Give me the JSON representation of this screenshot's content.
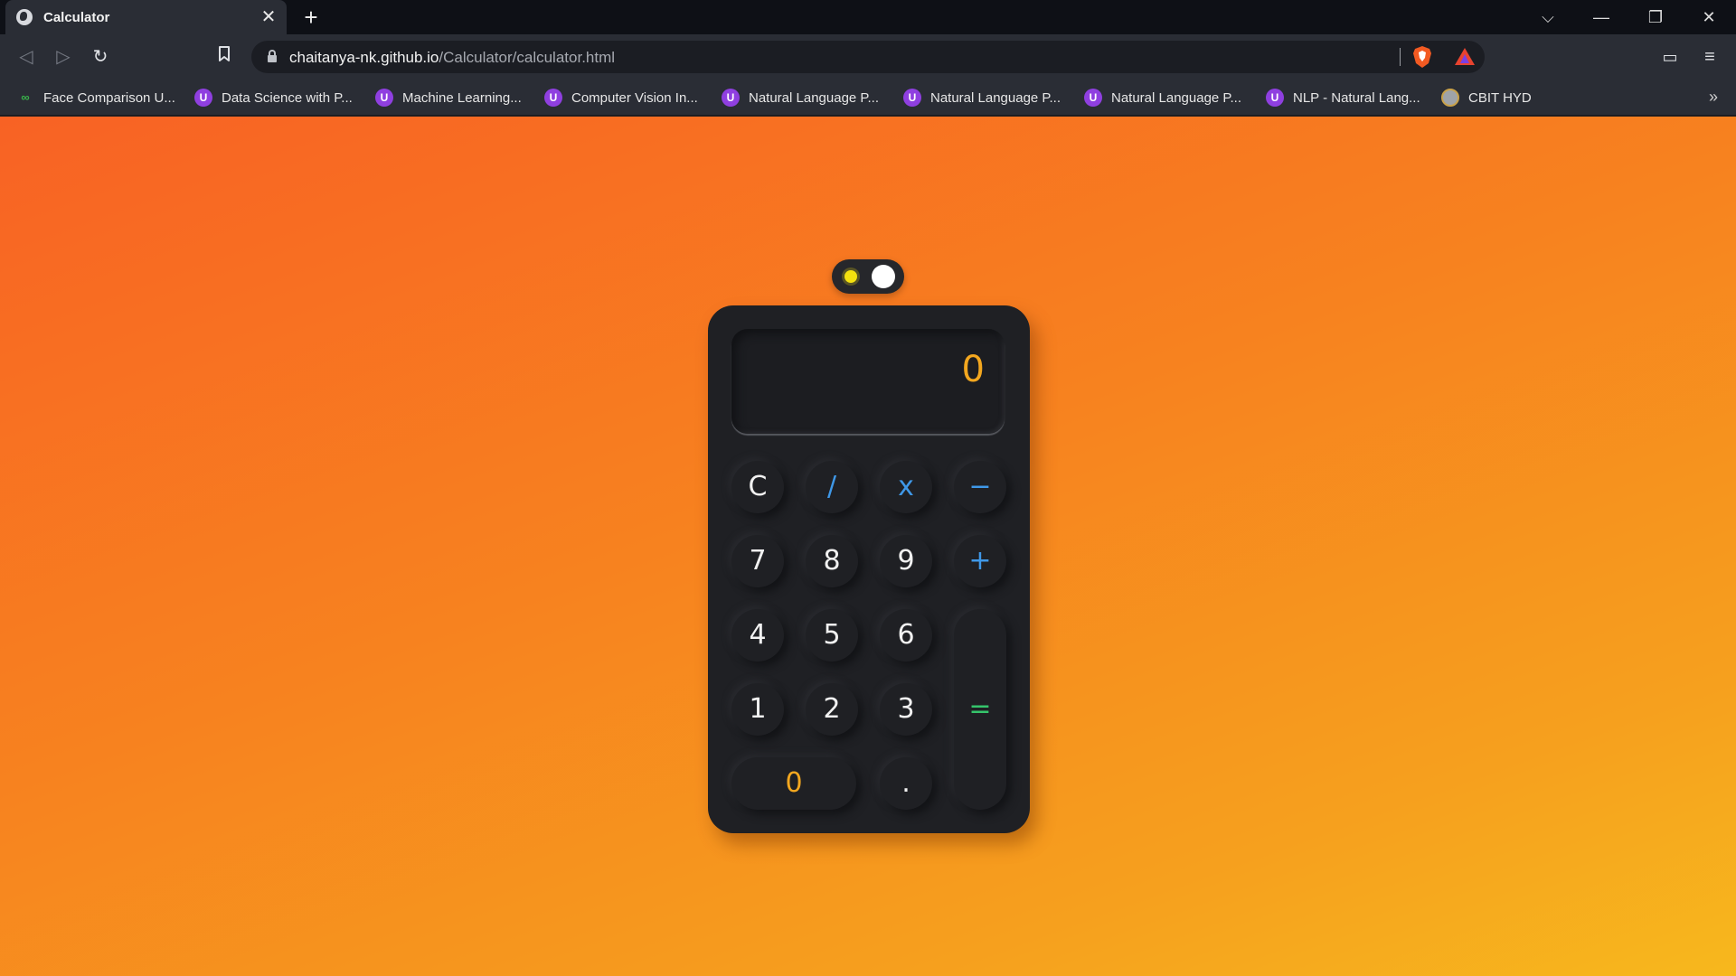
{
  "browser": {
    "tab": {
      "title": "Calculator",
      "favicon": "globe-icon",
      "close": "✕"
    },
    "new_tab": "+",
    "window_controls": {
      "tab_search": "⌵",
      "minimize": "—",
      "restore": "❐",
      "close": "✕"
    },
    "nav": {
      "back": "◁",
      "forward": "▷",
      "reload": "↻",
      "bookmark": "⌂"
    },
    "url": {
      "host": "chaitanya-nk.github.io",
      "path": "/Calculator/calculator.html"
    },
    "wallet": "▭",
    "menu": "≡"
  },
  "bookmarks": {
    "items": [
      {
        "label": "Face Comparison U...",
        "icon": "link-icon",
        "glyph": "∞"
      },
      {
        "label": "Data Science with P...",
        "icon": "udemy-icon",
        "glyph": "U"
      },
      {
        "label": "Machine Learning...",
        "icon": "udemy-icon",
        "glyph": "U"
      },
      {
        "label": "Computer Vision In...",
        "icon": "udemy-icon",
        "glyph": "U"
      },
      {
        "label": "Natural Language P...",
        "icon": "udemy-icon",
        "glyph": "U"
      },
      {
        "label": "Natural Language P...",
        "icon": "udemy-icon",
        "glyph": "U"
      },
      {
        "label": "Natural Language P...",
        "icon": "udemy-icon",
        "glyph": "U"
      },
      {
        "label": "NLP - Natural Lang...",
        "icon": "udemy-icon",
        "glyph": "U"
      },
      {
        "label": "CBIT HYD",
        "icon": "seal-icon",
        "glyph": ""
      }
    ],
    "more": "»"
  },
  "calculator": {
    "theme_toggle": {
      "state": "dark",
      "icon": "sun-icon"
    },
    "display": "0",
    "keys": {
      "clear": "C",
      "divide": "/",
      "multiply": "x",
      "subtract": "−",
      "seven": "7",
      "eight": "8",
      "nine": "9",
      "add": "+",
      "four": "4",
      "five": "5",
      "six": "6",
      "one": "1",
      "two": "2",
      "three": "3",
      "equals": "=",
      "zero": "0",
      "decimal": "."
    },
    "colors": {
      "display_text": "#f3a71f",
      "operator": "#3f98e8",
      "equals": "#35c46b",
      "body": "#1f2024",
      "background_start": "#f86224",
      "background_end": "#f7b81d"
    }
  }
}
